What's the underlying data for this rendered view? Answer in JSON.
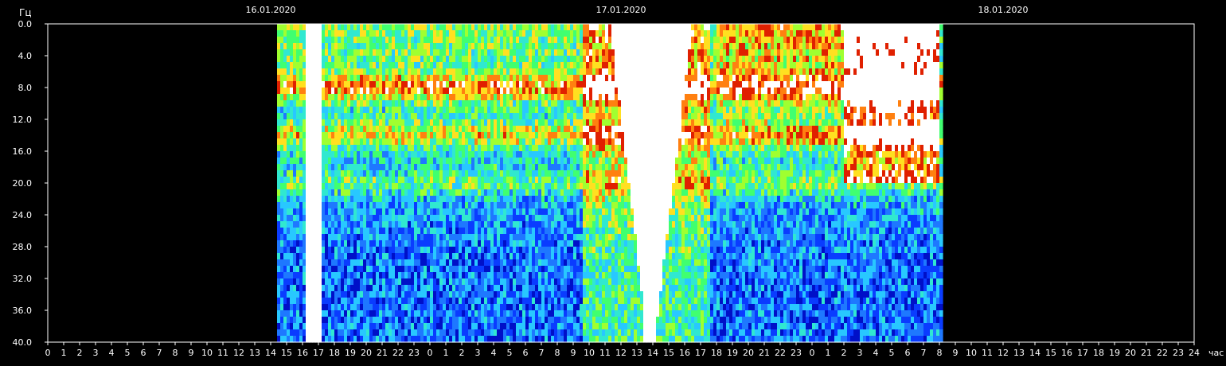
{
  "chart_data": {
    "type": "heatmap",
    "title": "",
    "ylabel": "Гц",
    "xlabel": "час",
    "ylim": [
      0,
      40
    ],
    "y_inverted": true,
    "y_ticks": [
      "0.0",
      "4.0",
      "8.0",
      "12.0",
      "16.0",
      "20.0",
      "24.0",
      "28.0",
      "32.0",
      "36.0",
      "40.0"
    ],
    "dates": [
      {
        "label": "16.01.2020",
        "at_hour": 14
      },
      {
        "label": "17.01.2020",
        "at_hour": 36
      },
      {
        "label": "18.01.2020",
        "at_hour": 60
      }
    ],
    "x_range_hours": [
      0,
      72
    ],
    "x_tick_labels": [
      "0",
      "1",
      "2",
      "3",
      "4",
      "5",
      "6",
      "7",
      "8",
      "9",
      "10",
      "11",
      "12",
      "13",
      "14",
      "15",
      "16",
      "17",
      "18",
      "19",
      "20",
      "21",
      "22",
      "23",
      "0",
      "1",
      "2",
      "3",
      "4",
      "5",
      "6",
      "7",
      "8",
      "9",
      "10",
      "11",
      "12",
      "13",
      "14",
      "15",
      "16",
      "17",
      "18",
      "19",
      "20",
      "21",
      "22",
      "23",
      "0",
      "1",
      "2",
      "3",
      "4",
      "5",
      "6",
      "7",
      "8",
      "9",
      "10",
      "11",
      "12",
      "13",
      "14",
      "15",
      "16",
      "17",
      "18",
      "19",
      "20",
      "21",
      "22",
      "23",
      "24"
    ],
    "data_coverage_hours": [
      14.4,
      56.1
    ],
    "colorscale": [
      "#000000",
      "#0010c8",
      "#0a3cff",
      "#1e78ff",
      "#28c8ff",
      "#30e8d0",
      "#40ff70",
      "#a0ff30",
      "#ffe020",
      "#ff8010",
      "#e02000",
      "#ffffff"
    ],
    "grid": false,
    "legend": "none"
  }
}
